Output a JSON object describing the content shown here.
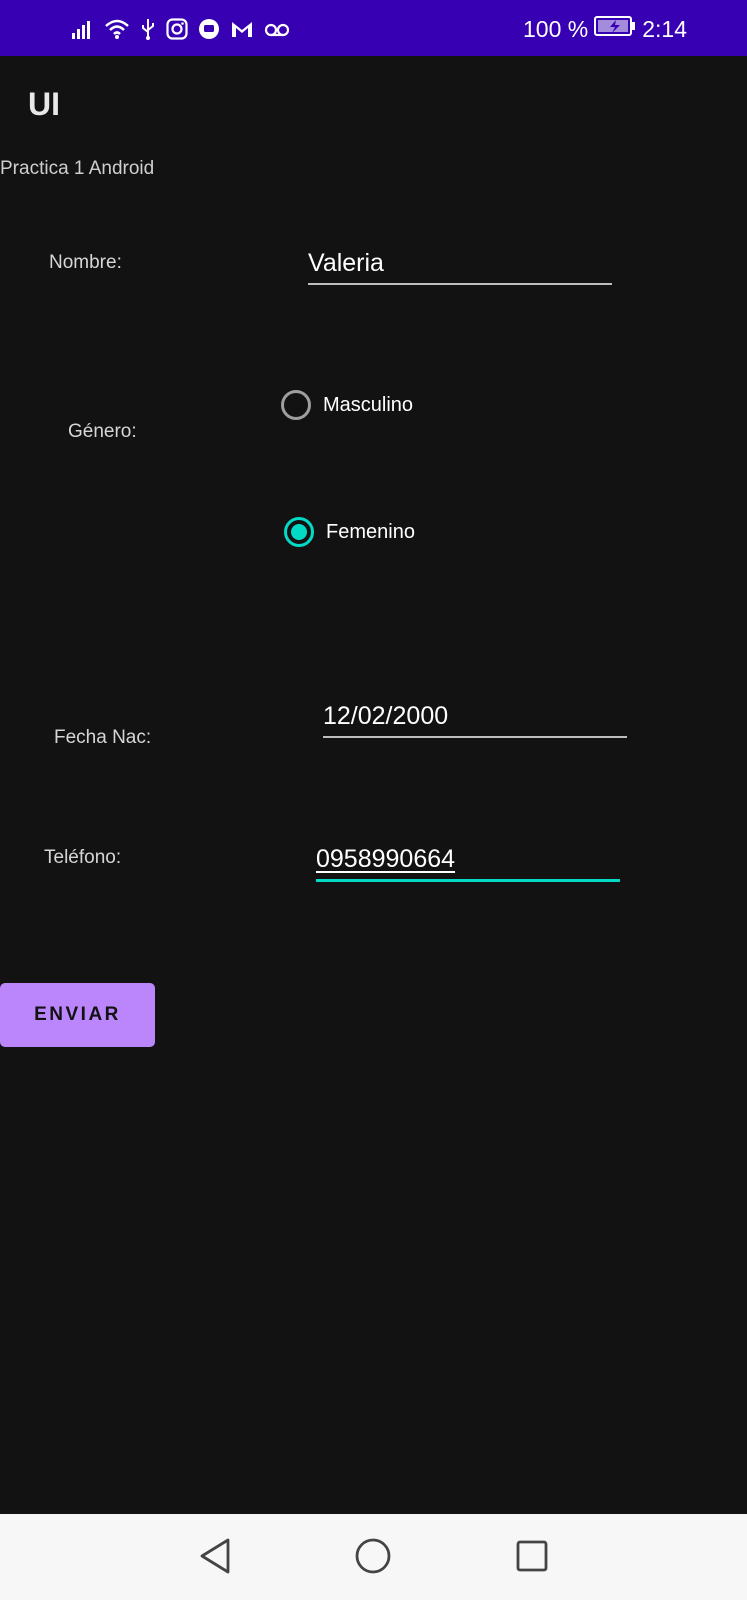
{
  "status_bar": {
    "battery_percent": "100 %",
    "battery_level": 1.0,
    "time": "2:14",
    "icons": [
      "signal-icon",
      "wifi-icon",
      "usb-icon",
      "instagram-icon",
      "messenger-icon",
      "gmail-icon",
      "voicemail-icon",
      "battery-charging-icon"
    ]
  },
  "app": {
    "title": "UI",
    "subtitle": "Practica 1 Android"
  },
  "form": {
    "nombre_label": "Nombre:",
    "nombre_value": "Valeria",
    "genero_label": "Género:",
    "genero_options": [
      {
        "label": "Masculino",
        "checked": false
      },
      {
        "label": "Femenino",
        "checked": true
      }
    ],
    "fecha_label": "Fecha Nac:",
    "fecha_value": "12/02/2000",
    "telefono_label": "Teléfono:",
    "telefono_value": "0958990664",
    "submit_label": "ENVIAR"
  },
  "nav_bar": {
    "icons": [
      "back-icon",
      "home-icon",
      "recents-icon"
    ]
  },
  "colors": {
    "status_bar": "#3700b3",
    "background": "#121212",
    "accent": "#03dac5",
    "button": "#bb86fc"
  }
}
